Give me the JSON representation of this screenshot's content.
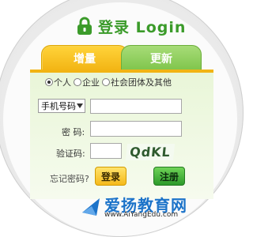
{
  "header": {
    "title": "登录 Login",
    "lock_icon": "lock-icon",
    "accent_color": "#3b9b2a"
  },
  "tabs": [
    {
      "label": "增量",
      "active": true,
      "color": "#f2b413"
    },
    {
      "label": "更新",
      "active": false,
      "color": "#7ec44a"
    }
  ],
  "user_type": {
    "options": [
      "个人",
      "企业",
      "社会团体及其他"
    ],
    "selected": "个人"
  },
  "form": {
    "id_type": {
      "selected": "手机号码"
    },
    "id_value": "",
    "password_label": "密 码:",
    "password_value": "",
    "captcha_label": "验证码:",
    "captcha_value": "",
    "captcha_text": "QdKL"
  },
  "actions": {
    "forgot_label": "忘记密码?",
    "login_label": "登录",
    "register_label": "注册"
  },
  "watermark": {
    "text": "爱扬教育网",
    "url": "www.AiYangEdu.com"
  }
}
